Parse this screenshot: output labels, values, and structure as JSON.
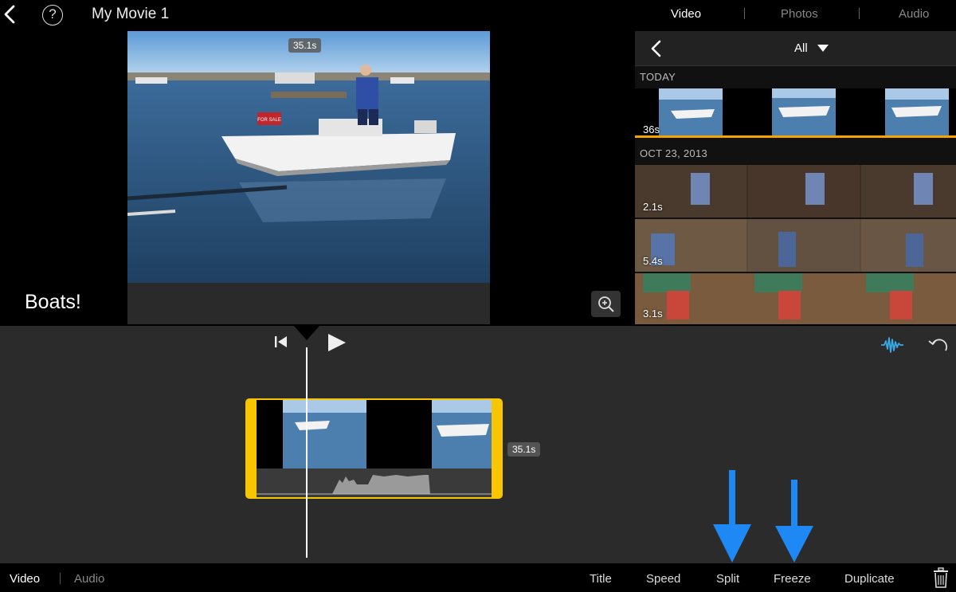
{
  "topbar": {
    "movie_title": "My Movie 1",
    "help_label": "?",
    "media_tabs": [
      "Video",
      "Photos",
      "Audio"
    ]
  },
  "viewer": {
    "duration": "35.1s",
    "title_text": "Boats!",
    "boat_sign": "FOR SALE"
  },
  "browser": {
    "filter": "All",
    "sections": [
      {
        "label": "TODAY",
        "durations": [
          "36s"
        ]
      },
      {
        "label": "OCT 23, 2013",
        "durations": [
          "2.1s",
          "5.4s",
          "3.1s"
        ]
      }
    ]
  },
  "timeline": {
    "clip_duration": "35.1s"
  },
  "toolbar": {
    "video": "Video",
    "audio": "Audio",
    "title": "Title",
    "speed": "Speed",
    "split": "Split",
    "freeze": "Freeze",
    "duplicate": "Duplicate"
  },
  "colors": {
    "clip_border": "#f7c600",
    "used_marker": "#f5a300",
    "annotation_arrow": "#1e88f5",
    "waveform_icon": "#3aa7e8"
  },
  "icons": [
    "back-icon",
    "help-icon",
    "zoom-icon",
    "skip-back-icon",
    "play-icon",
    "waveform-icon",
    "undo-icon",
    "trash-icon",
    "chevron-left-icon",
    "caret-down-icon"
  ]
}
